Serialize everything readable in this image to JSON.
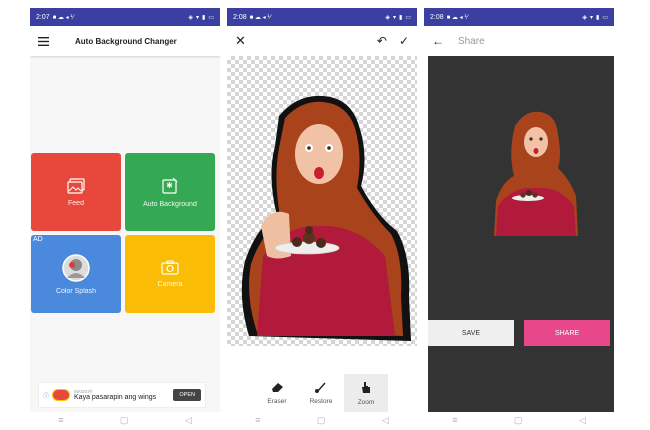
{
  "screen1": {
    "status": {
      "time": "2:07"
    },
    "title": "Auto Background Changer",
    "tiles": [
      {
        "label": "Feed",
        "color": "#e8483b"
      },
      {
        "label": "Auto Background",
        "color": "#35a853"
      },
      {
        "label": "Color Splash",
        "color": "#4a89dc",
        "badge": "AD"
      },
      {
        "label": "Camera",
        "color": "#fbbc05"
      }
    ],
    "ad": {
      "brand": "MAGGI®",
      "text": "Kaya pasarapin ang wings",
      "cta": "OPEN"
    }
  },
  "screen2": {
    "status": {
      "time": "2:08"
    },
    "tools": [
      {
        "label": "Eraser",
        "icon": "eraser-icon"
      },
      {
        "label": "Restore",
        "icon": "brush-icon"
      },
      {
        "label": "Zoom",
        "icon": "hand-icon"
      }
    ]
  },
  "screen3": {
    "status": {
      "time": "2:08"
    },
    "title": "Share",
    "save_label": "SAVE",
    "share_label": "SHARE",
    "share_color": "#e8478a"
  }
}
